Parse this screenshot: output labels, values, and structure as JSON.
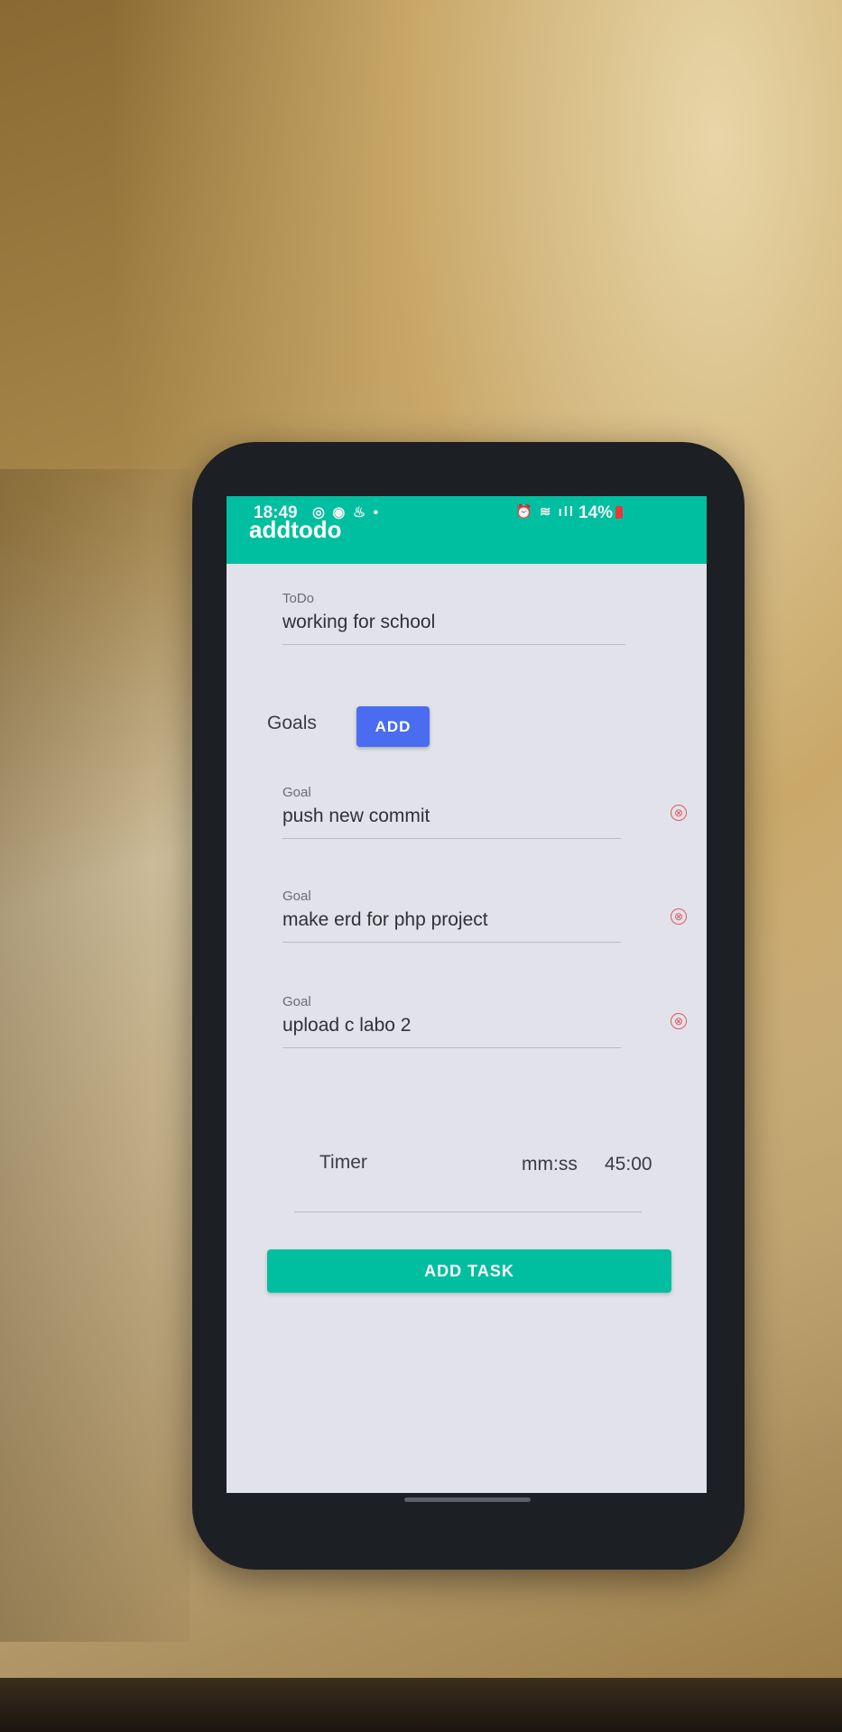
{
  "status_bar": {
    "time": "18:49",
    "left_icons": "◎ ◉ ♨ •",
    "right_icons": "⏰ ≋ ıll",
    "battery": "14%"
  },
  "app_bar": {
    "title": "addtodo"
  },
  "todo": {
    "label": "ToDo",
    "value": "working for school"
  },
  "goals": {
    "label": "Goals",
    "add_label": "ADD",
    "items": [
      {
        "label": "Goal",
        "value": "push new commit",
        "remove_icon": "⊗"
      },
      {
        "label": "Goal",
        "value": "make erd for php project",
        "remove_icon": "⊗"
      },
      {
        "label": "Goal",
        "value": "upload c labo 2",
        "remove_icon": "⊗"
      }
    ]
  },
  "timer": {
    "label": "Timer",
    "format": "mm:ss",
    "value": "45:00"
  },
  "add_task_label": "ADD TASK",
  "colors": {
    "primary": "#00bfa0",
    "accent_button": "#4a6cf0",
    "remove": "#e05562",
    "screen_bg": "#e2e3ea"
  }
}
